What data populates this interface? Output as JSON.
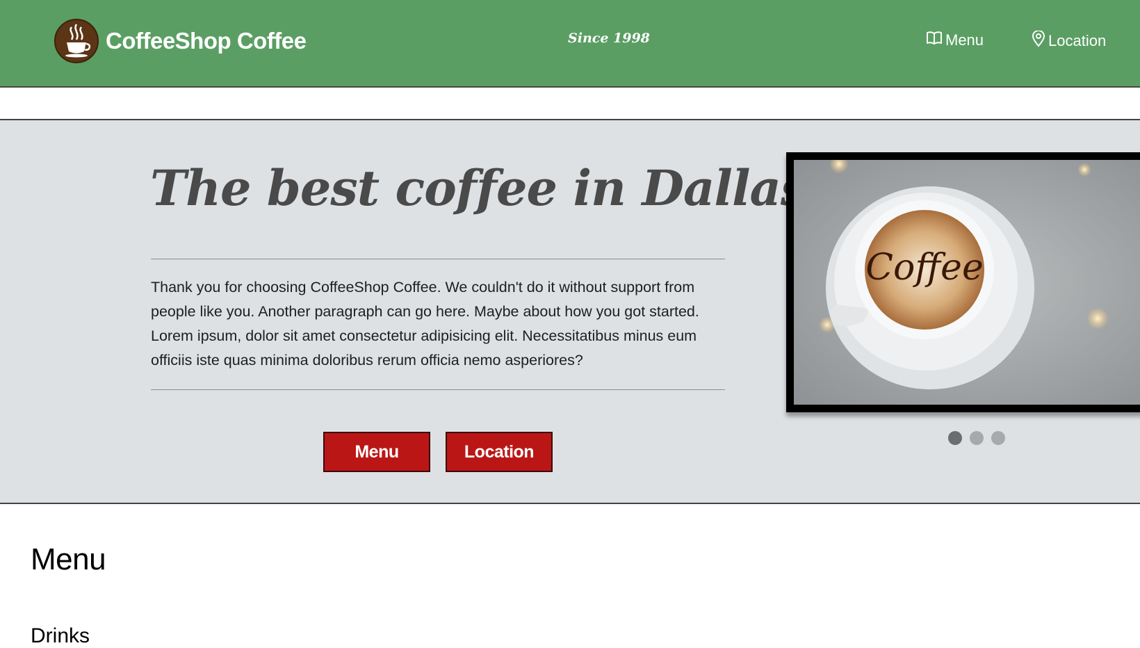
{
  "header": {
    "brand_name": "CoffeeShop Coffee",
    "tagline": "Since 1998",
    "nav": {
      "menu_label": "Menu",
      "menu_icon": "book-icon",
      "location_label": "Location",
      "location_icon": "map-pin-icon"
    },
    "logo_icon": "coffee-cup-icon"
  },
  "hero": {
    "title": "The best coffee in Dallas",
    "paragraph": "Thank you for choosing CoffeeShop Coffee. We couldn't do it without support from people like you. Another paragraph can go here. Maybe about how you got started. Lorem ipsum, dolor sit amet consectetur adipisicing elit. Necessitatibus minus eum officiis iste quas minima doloribus rerum officia nemo asperiores?",
    "buttons": {
      "menu_label": "Menu",
      "location_label": "Location"
    },
    "carousel": {
      "image_text": "Coffee",
      "slide_count": 3,
      "active_slide": 1
    }
  },
  "menu_section": {
    "title": "Menu",
    "subheading": "Drinks"
  },
  "colors": {
    "header_bg": "#5a9e63",
    "hero_bg": "#dee1e4",
    "button_bg": "#bb1616",
    "logo_bg": "#5b3516"
  }
}
